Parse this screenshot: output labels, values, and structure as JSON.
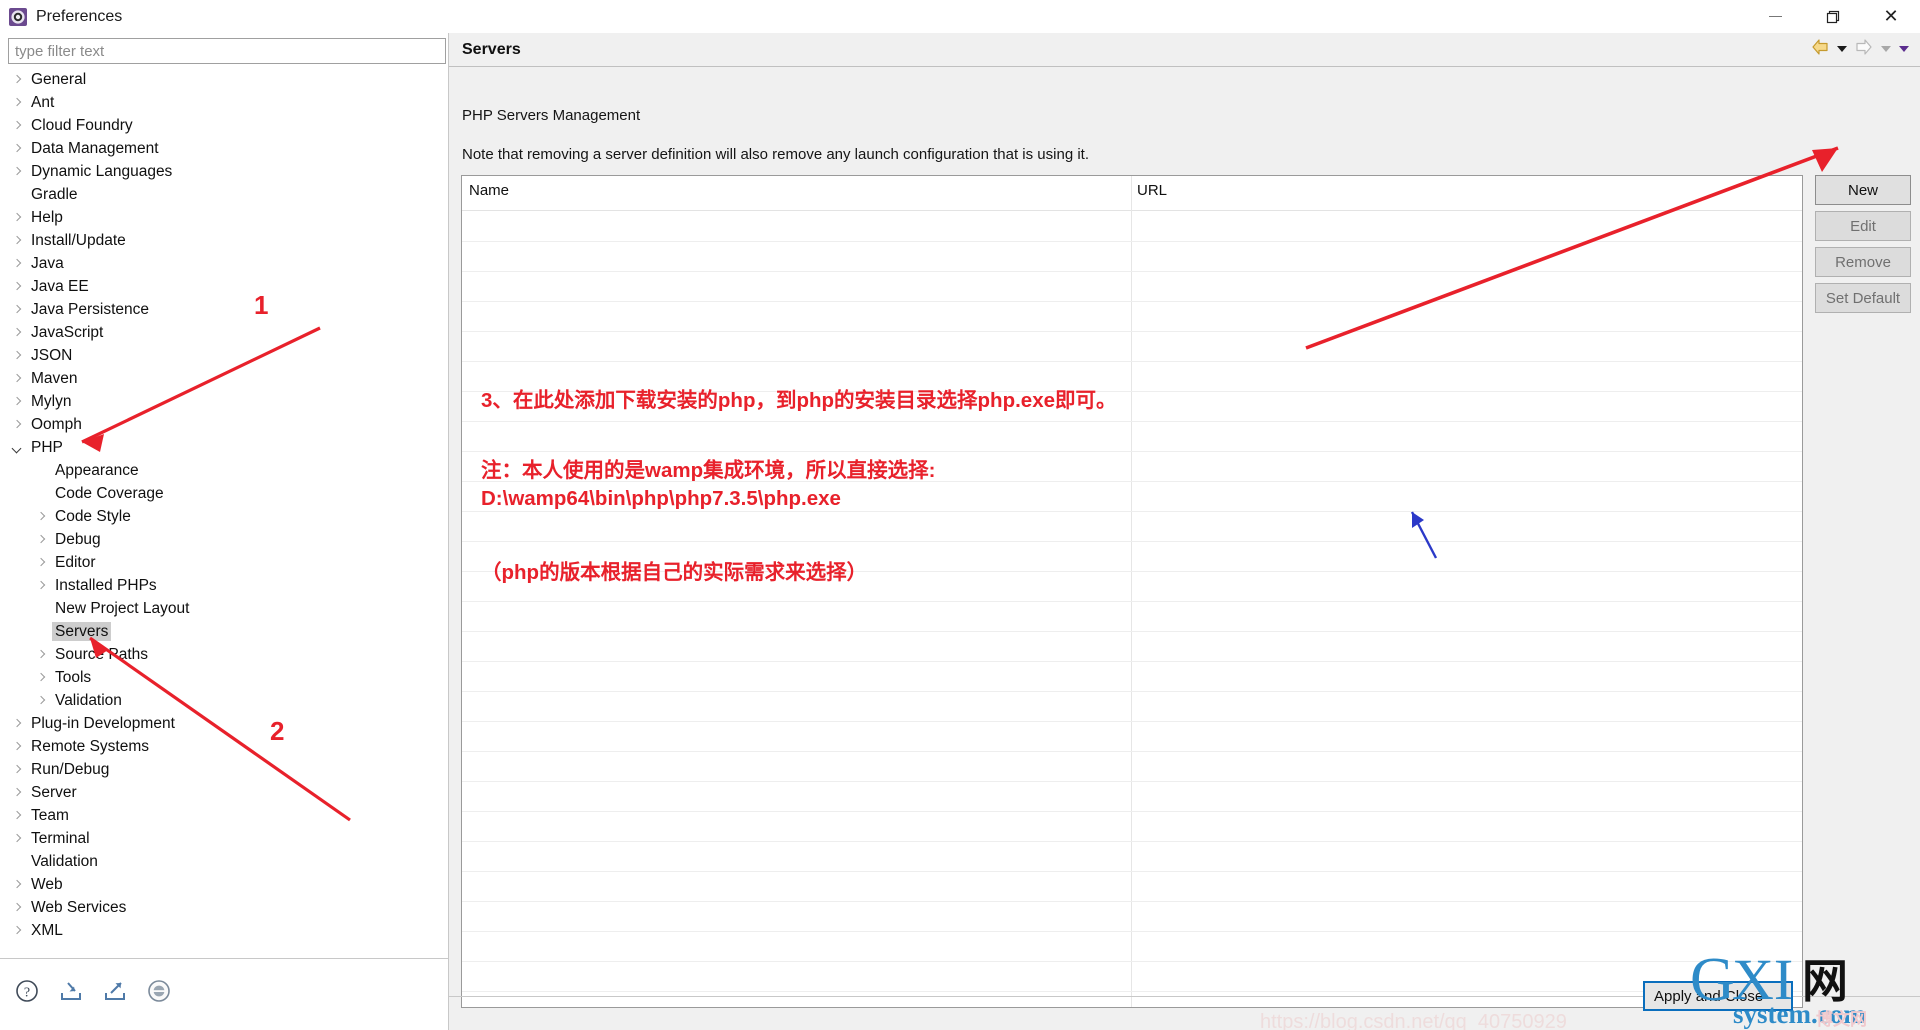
{
  "window": {
    "title": "Preferences",
    "icon": "preferences-gear-icon",
    "controls": {
      "minimize": "minimize-icon",
      "restore": "restore-icon",
      "close": "close-icon"
    }
  },
  "filter": {
    "placeholder": "type filter text",
    "value": ""
  },
  "tree": {
    "selected": "Servers",
    "items": [
      {
        "label": "General",
        "depth": 0,
        "twisty": "closed"
      },
      {
        "label": "Ant",
        "depth": 0,
        "twisty": "closed"
      },
      {
        "label": "Cloud Foundry",
        "depth": 0,
        "twisty": "closed"
      },
      {
        "label": "Data Management",
        "depth": 0,
        "twisty": "closed"
      },
      {
        "label": "Dynamic Languages",
        "depth": 0,
        "twisty": "closed"
      },
      {
        "label": "Gradle",
        "depth": 0,
        "twisty": "none"
      },
      {
        "label": "Help",
        "depth": 0,
        "twisty": "closed"
      },
      {
        "label": "Install/Update",
        "depth": 0,
        "twisty": "closed"
      },
      {
        "label": "Java",
        "depth": 0,
        "twisty": "closed"
      },
      {
        "label": "Java EE",
        "depth": 0,
        "twisty": "closed"
      },
      {
        "label": "Java Persistence",
        "depth": 0,
        "twisty": "closed"
      },
      {
        "label": "JavaScript",
        "depth": 0,
        "twisty": "closed"
      },
      {
        "label": "JSON",
        "depth": 0,
        "twisty": "closed"
      },
      {
        "label": "Maven",
        "depth": 0,
        "twisty": "closed"
      },
      {
        "label": "Mylyn",
        "depth": 0,
        "twisty": "closed"
      },
      {
        "label": "Oomph",
        "depth": 0,
        "twisty": "closed"
      },
      {
        "label": "PHP",
        "depth": 0,
        "twisty": "open"
      },
      {
        "label": "Appearance",
        "depth": 1,
        "twisty": "none"
      },
      {
        "label": "Code Coverage",
        "depth": 1,
        "twisty": "none"
      },
      {
        "label": "Code Style",
        "depth": 1,
        "twisty": "closed"
      },
      {
        "label": "Debug",
        "depth": 1,
        "twisty": "closed"
      },
      {
        "label": "Editor",
        "depth": 1,
        "twisty": "closed"
      },
      {
        "label": "Installed PHPs",
        "depth": 1,
        "twisty": "closed"
      },
      {
        "label": "New Project Layout",
        "depth": 1,
        "twisty": "none"
      },
      {
        "label": "Servers",
        "depth": 1,
        "twisty": "none",
        "selected": true
      },
      {
        "label": "Source Paths",
        "depth": 1,
        "twisty": "closed"
      },
      {
        "label": "Tools",
        "depth": 1,
        "twisty": "closed"
      },
      {
        "label": "Validation",
        "depth": 1,
        "twisty": "closed"
      },
      {
        "label": "Plug-in Development",
        "depth": 0,
        "twisty": "closed"
      },
      {
        "label": "Remote Systems",
        "depth": 0,
        "twisty": "closed"
      },
      {
        "label": "Run/Debug",
        "depth": 0,
        "twisty": "closed"
      },
      {
        "label": "Server",
        "depth": 0,
        "twisty": "closed"
      },
      {
        "label": "Team",
        "depth": 0,
        "twisty": "closed"
      },
      {
        "label": "Terminal",
        "depth": 0,
        "twisty": "closed"
      },
      {
        "label": "Validation",
        "depth": 0,
        "twisty": "none"
      },
      {
        "label": "Web",
        "depth": 0,
        "twisty": "closed"
      },
      {
        "label": "Web Services",
        "depth": 0,
        "twisty": "closed"
      },
      {
        "label": "XML",
        "depth": 0,
        "twisty": "closed"
      }
    ]
  },
  "bottom_icons": [
    {
      "name": "help-icon"
    },
    {
      "name": "import-icon"
    },
    {
      "name": "export-icon"
    },
    {
      "name": "restore-defaults-icon"
    }
  ],
  "panel": {
    "title": "Servers",
    "subtitle": "PHP Servers Management",
    "note": "Note that removing a server definition will also remove any launch configuration that is using it.",
    "nav": {
      "back": "back-arrow-icon",
      "back_menu": "back-dropdown-icon",
      "forward": "forward-arrow-icon",
      "forward_menu": "forward-dropdown-icon",
      "view_menu": "view-menu-dropdown-icon"
    },
    "table": {
      "columns": [
        "Name",
        "URL"
      ],
      "rows": []
    },
    "buttons": [
      {
        "label": "New",
        "enabled": true
      },
      {
        "label": "Edit",
        "enabled": false
      },
      {
        "label": "Remove",
        "enabled": false
      },
      {
        "label": "Set Default",
        "enabled": false
      }
    ],
    "apply_button": "Apply and Close"
  },
  "annotations": {
    "marker1": "1",
    "marker2": "2",
    "line1": "3、在此处添加下载安装的php，到php的安装目录选择php.exe即可。",
    "line2": "注：本人使用的是wamp集成环境，所以直接选择:",
    "line3": "D:\\wamp64\\bin\\php\\php7.3.5\\php.exe",
    "line4": "（php的版本根据自己的实际需求来选择）",
    "color_red": "#e8212b",
    "color_blue": "#2b39c8"
  },
  "watermark": {
    "g": "G",
    "x": "XI",
    "net": "网",
    "system": "system.com",
    "ghost": "博文网"
  }
}
